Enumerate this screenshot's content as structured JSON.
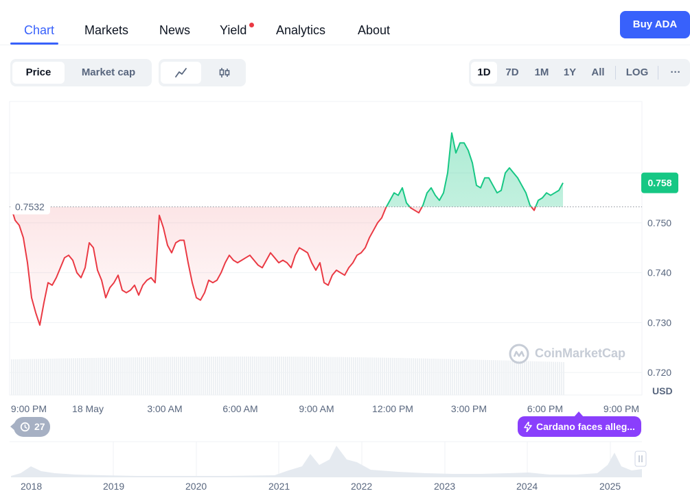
{
  "nav": {
    "tabs": [
      "Chart",
      "Markets",
      "News",
      "Yield",
      "Analytics",
      "About"
    ],
    "buy_label": "Buy ADA"
  },
  "toolbar": {
    "price_label": "Price",
    "market_cap_label": "Market cap",
    "line_icon": "line-chart-icon",
    "candle_icon": "candlestick-icon",
    "ranges": [
      "1D",
      "7D",
      "1M",
      "1Y",
      "All"
    ],
    "active_range": "1D",
    "log_label": "LOG",
    "more_label": "···"
  },
  "colors": {
    "accent": "#3861fb",
    "up": "#16c784",
    "down": "#ea3943",
    "news": "#8a3ffc"
  },
  "chart_data": {
    "type": "area",
    "reference_value": 0.7532,
    "reference_label": "0.7532",
    "current_value": 0.758,
    "current_label": "0.758",
    "ylabel": "USD",
    "ylim": [
      0.7155,
      0.7743
    ],
    "y_ticks": [
      {
        "v": 0.75,
        "label": "0.750"
      },
      {
        "v": 0.74,
        "label": "0.740"
      },
      {
        "v": 0.73,
        "label": "0.730"
      },
      {
        "v": 0.72,
        "label": "0.720"
      }
    ],
    "x_ticks": [
      "9:00 PM",
      "18 May",
      "3:00 AM",
      "6:00 AM",
      "9:00 AM",
      "12:00 PM",
      "3:00 PM",
      "6:00 PM",
      "9:00 PM"
    ],
    "grid": true,
    "watermark": "CoinMarketCap",
    "series": [
      {
        "values": [
          0.7532,
          0.7505,
          0.7495,
          0.747,
          0.742,
          0.735,
          0.732,
          0.7295,
          0.734,
          0.738,
          0.7375,
          0.739,
          0.741,
          0.743,
          0.7435,
          0.7425,
          0.74,
          0.739,
          0.741,
          0.746,
          0.745,
          0.7405,
          0.7385,
          0.735,
          0.737,
          0.738,
          0.7395,
          0.7365,
          0.736,
          0.7365,
          0.7375,
          0.7355,
          0.7375,
          0.7385,
          0.739,
          0.738,
          0.7515,
          0.749,
          0.7455,
          0.744,
          0.746,
          0.7465,
          0.7465,
          0.742,
          0.738,
          0.735,
          0.7345,
          0.736,
          0.7385,
          0.738,
          0.7385,
          0.74,
          0.742,
          0.7435,
          0.7425,
          0.742,
          0.7425,
          0.743,
          0.7435,
          0.7425,
          0.7415,
          0.741,
          0.7425,
          0.744,
          0.743,
          0.742,
          0.7425,
          0.742,
          0.741,
          0.7435,
          0.745,
          0.7445,
          0.744,
          0.742,
          0.7405,
          0.742,
          0.738,
          0.7375,
          0.7395,
          0.7405,
          0.74,
          0.7395,
          0.741,
          0.742,
          0.7435,
          0.744,
          0.745,
          0.747,
          0.7485,
          0.75,
          0.751,
          0.753,
          0.7545,
          0.756,
          0.7555,
          0.757,
          0.754,
          0.753,
          0.7525,
          0.752,
          0.7535,
          0.756,
          0.757,
          0.7555,
          0.7545,
          0.756,
          0.76,
          0.768,
          0.764,
          0.766,
          0.766,
          0.7645,
          0.762,
          0.7575,
          0.757,
          0.759,
          0.759,
          0.7575,
          0.756,
          0.7565,
          0.76,
          0.761,
          0.76,
          0.759,
          0.7575,
          0.756,
          0.7535,
          0.7525,
          0.7545,
          0.755,
          0.756,
          0.7555,
          0.756,
          0.7565,
          0.758
        ]
      }
    ]
  },
  "history_badge": "27",
  "news_badge": "Cardano faces alleg...",
  "overview": {
    "years": [
      "2018",
      "2019",
      "2020",
      "2021",
      "2022",
      "2023",
      "2024",
      "2025"
    ]
  }
}
